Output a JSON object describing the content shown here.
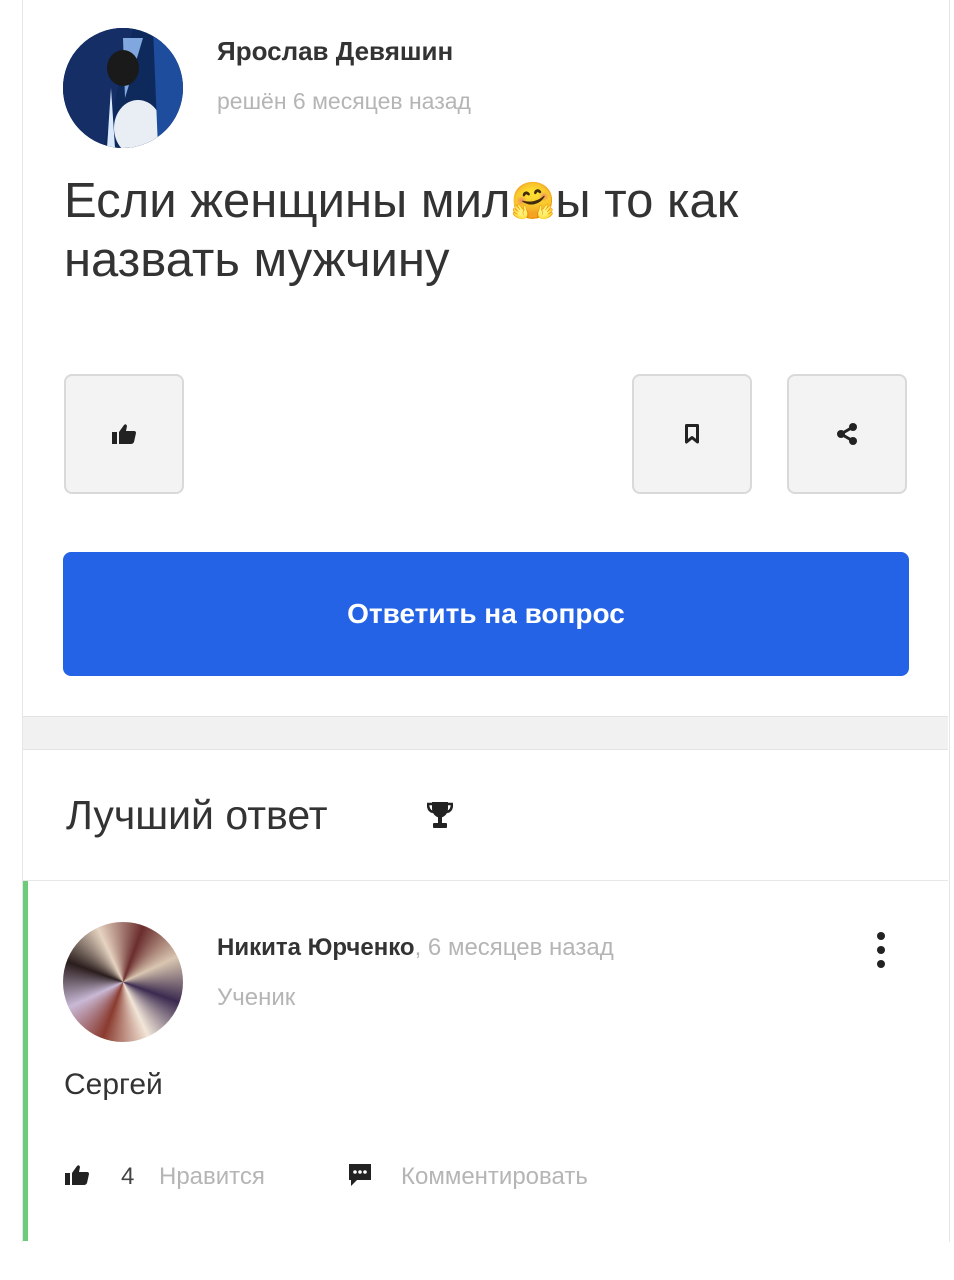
{
  "question": {
    "author_name": "Ярослав Девяшин",
    "meta": "решён 6 месяцев назад",
    "text_before": "Если женщины мил",
    "emoji": "🤗",
    "text_after": "ы то как назвать мужчину"
  },
  "actions": {
    "like_icon": "thumbs-up-icon",
    "bookmark_icon": "bookmark-icon",
    "share_icon": "share-icon",
    "answer_button_label": "Ответить на вопрос"
  },
  "best_answer": {
    "heading": "Лучший ответ",
    "heading_icon": "trophy-icon",
    "author_name": "Никита Юрченко",
    "time": "6 месяцев назад",
    "role": "Ученик",
    "text": "Сергей",
    "like_count": "4",
    "like_label": "Нравится",
    "comment_label": "Комментировать"
  },
  "colors": {
    "primary_button": "#2463e6",
    "best_answer_accent": "#6ccc79",
    "muted_text": "#b5b5b5"
  }
}
